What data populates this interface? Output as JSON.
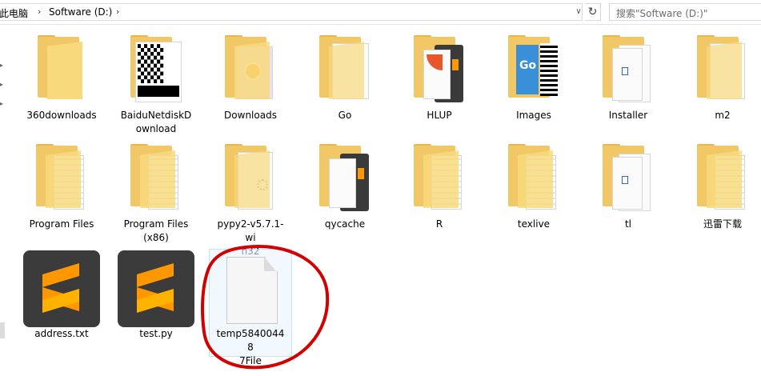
{
  "addressbar": {
    "breadcrumb": [
      "此电脑",
      "Software (D:)"
    ],
    "dropdown_glyph": "∨",
    "refresh_icon": "↻"
  },
  "search": {
    "placeholder": "搜索\"Software (D:)\"",
    "icon": "search-icon"
  },
  "colors": {
    "folder": "#f8d97c",
    "selection_border": "#99d1ff",
    "annotation_circle": "#d40000",
    "sublime_bg": "#3b3b3b",
    "sublime_orange": "#ff9800"
  },
  "items": [
    {
      "name": "360downloads",
      "type": "folder"
    },
    {
      "name": "BaiduNetdiskDownload",
      "type": "folder",
      "lines": [
        "BaiduNetdiskD",
        "ownload"
      ]
    },
    {
      "name": "Downloads",
      "type": "folder"
    },
    {
      "name": "Go",
      "type": "folder"
    },
    {
      "name": "HLUP",
      "type": "folder"
    },
    {
      "name": "Images",
      "type": "folder"
    },
    {
      "name": "Installer",
      "type": "folder"
    },
    {
      "name": "m2",
      "type": "folder"
    },
    {
      "name": "Program Files",
      "type": "folder"
    },
    {
      "name": "Program Files (x86)",
      "type": "folder",
      "lines": [
        "Program Files",
        "(x86)"
      ]
    },
    {
      "name": "pypy2-v5.7.1-win32",
      "type": "folder",
      "lines": [
        "pypy2-v5.7.1-wi",
        "n32"
      ]
    },
    {
      "name": "qycache",
      "type": "folder"
    },
    {
      "name": "R",
      "type": "folder"
    },
    {
      "name": "texlive",
      "type": "folder"
    },
    {
      "name": "tl",
      "type": "folder"
    },
    {
      "name": "迅雷下载",
      "type": "folder"
    },
    {
      "name": "address.txt",
      "type": "sublime-file"
    },
    {
      "name": "test.py",
      "type": "sublime-file"
    },
    {
      "name": "temp584004487File",
      "type": "file",
      "lines": [
        "temp58400448",
        "7File"
      ],
      "selected": true
    }
  ]
}
